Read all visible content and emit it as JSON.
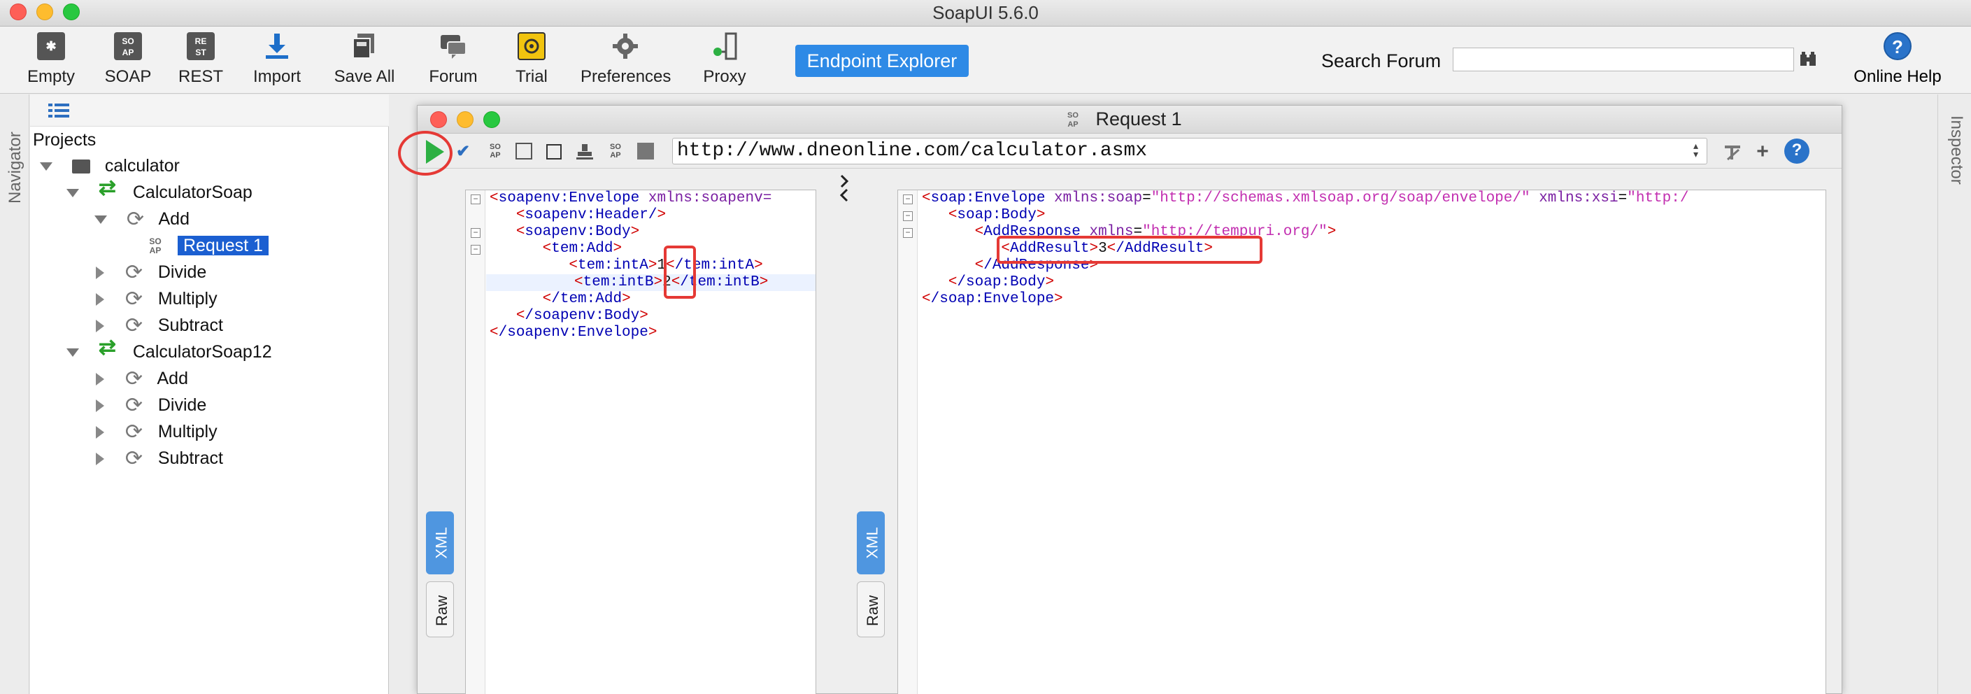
{
  "window": {
    "title": "SoapUI 5.6.0"
  },
  "toolbar": {
    "buttons": [
      {
        "label": "Empty",
        "icon": "empty-project-icon"
      },
      {
        "label": "SOAP",
        "icon": "soap-project-icon"
      },
      {
        "label": "REST",
        "icon": "rest-project-icon"
      },
      {
        "label": "Import",
        "icon": "import-icon"
      },
      {
        "label": "Save All",
        "icon": "save-all-icon"
      },
      {
        "label": "Forum",
        "icon": "forum-icon"
      },
      {
        "label": "Trial",
        "icon": "trial-icon"
      },
      {
        "label": "Preferences",
        "icon": "gear-icon"
      },
      {
        "label": "Proxy",
        "icon": "proxy-icon"
      }
    ],
    "endpoint_explorer": "Endpoint Explorer",
    "search_label": "Search Forum",
    "search_value": "",
    "online_help": "Online Help",
    "help_glyph": "?",
    "icon_text": {
      "empty": "✱",
      "soap_top": "SO",
      "soap_bottom": "AP",
      "rest_top": "RE",
      "rest_bottom": "ST"
    }
  },
  "navigator": {
    "strip_label": "Navigator",
    "header": "Projects",
    "tree": {
      "project": "calculator",
      "interface_1": "CalculatorSoap",
      "op_add": "Add",
      "request": "Request 1",
      "op_divide": "Divide",
      "op_multiply": "Multiply",
      "op_subtract": "Subtract",
      "interface_2": "CalculatorSoap12",
      "op2_add": "Add",
      "op2_divide": "Divide",
      "op2_multiply": "Multiply",
      "op2_subtract": "Subtract"
    },
    "soap_icon_top": "SO",
    "soap_icon_bottom": "AP"
  },
  "inspector": {
    "strip_label": "Inspector"
  },
  "request_window": {
    "title": "Request 1",
    "title_icon_top": "SO",
    "title_icon_bottom": "AP",
    "endpoint_url": "http://www.dneonline.com/calculator.asmx",
    "help_glyph": "?",
    "request_tabs": {
      "xml": "XML",
      "raw": "Raw"
    },
    "response_tabs": {
      "xml": "XML",
      "raw": "Raw"
    },
    "request_xml": {
      "l1_tag": "soapenv:Envelope",
      "l1_attr": "xmlns:soapenv",
      "l1_rest": "=",
      "l2": "soapenv:Header/",
      "l3": "soapenv:Body",
      "l4": "tem:Add",
      "l5_tag": "tem:intA",
      "l5_val": "1",
      "l5_close": "/tem:intA",
      "l6_tag": "tem:intB",
      "l6_val": "2",
      "l6_close": "/tem:intB",
      "l7": "/tem:Add",
      "l8": "/soapenv:Body",
      "l9": "/soapenv:Envelope"
    },
    "response_xml": {
      "l1_tag": "soap:Envelope",
      "l1_attr1": "xmlns:soap",
      "l1_val1": "\"http://schemas.xmlsoap.org/soap/envelope/\"",
      "l1_attr2": "xmlns:xsi",
      "l1_val2": "\"http:/",
      "l2": "soap:Body",
      "l3_tag": "AddResponse",
      "l3_attr": "xmlns",
      "l3_val": "\"http://tempuri.org/\"",
      "l4_tag": "AddResult",
      "l4_val": "3",
      "l4_close": "/AddResult",
      "l5": "/AddResponse",
      "l6": "/soap:Body",
      "l7": "/soap:Envelope"
    }
  },
  "colors": {
    "accent": "#2e8ae6",
    "selection": "#1b5fd1",
    "run": "#2db043",
    "annotation": "#e53935"
  }
}
